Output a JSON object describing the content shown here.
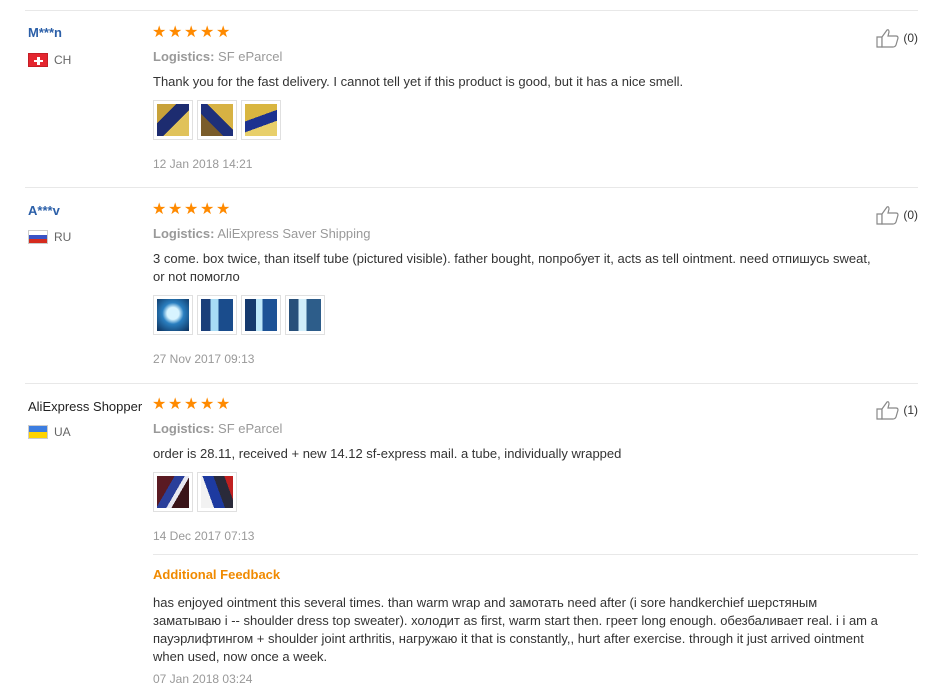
{
  "reviews": [
    {
      "user": "M***n",
      "country": "CH",
      "stars": 5,
      "logistics_label": "Logistics:",
      "logistics": "SF eParcel",
      "text": "Thank you for the fast delivery. I cannot tell yet if this product is good, but it has a nice smell.",
      "photo_count": 3,
      "date": "12 Jan 2018 14:21",
      "likes": "(0)"
    },
    {
      "user": "A***v",
      "country": "RU",
      "stars": 5,
      "logistics_label": "Logistics:",
      "logistics": "AliExpress Saver Shipping",
      "text_line1": "3 come. box twice, than itself tube (pictured visible). father bought, попробует it, acts as tell ointment. need отпишусь sweat,",
      "text_line2": "or not помогло",
      "photo_count": 4,
      "date": "27 Nov 2017 09:13",
      "likes": "(0)"
    },
    {
      "user": "AliExpress Shopper",
      "country": "UA",
      "stars": 5,
      "logistics_label": "Logistics:",
      "logistics": "SF eParcel",
      "text": "order is 28.11, received + new 14.12 sf-express mail. a tube, individually wrapped",
      "photo_count": 2,
      "date": "14 Dec 2017 07:13",
      "likes": "(1)",
      "additional_feedback": {
        "title": "Additional Feedback",
        "line1": "has enjoyed ointment this several times. than warm wrap and замотать need after (i sore handkerchief шерстяным",
        "line2": "заматываю i -- shoulder dress top sweater). холодит as first, warm start then. греет long enough. обезбаливает real. i i am a",
        "line3": "пауэрлифтингом + shoulder joint arthritis, нагружаю it that is constantly,, hurt after exercise. through it just arrived ointment",
        "line4": "when used, now once a week.",
        "date": "07 Jan 2018 03:24"
      }
    }
  ],
  "colors": {
    "accent": "#ff8a00",
    "link": "#2b5fa8",
    "muted": "#999999",
    "feedback_title": "#f08a00"
  },
  "icons": {
    "star": "star-icon",
    "like": "thumbs-up-icon"
  }
}
